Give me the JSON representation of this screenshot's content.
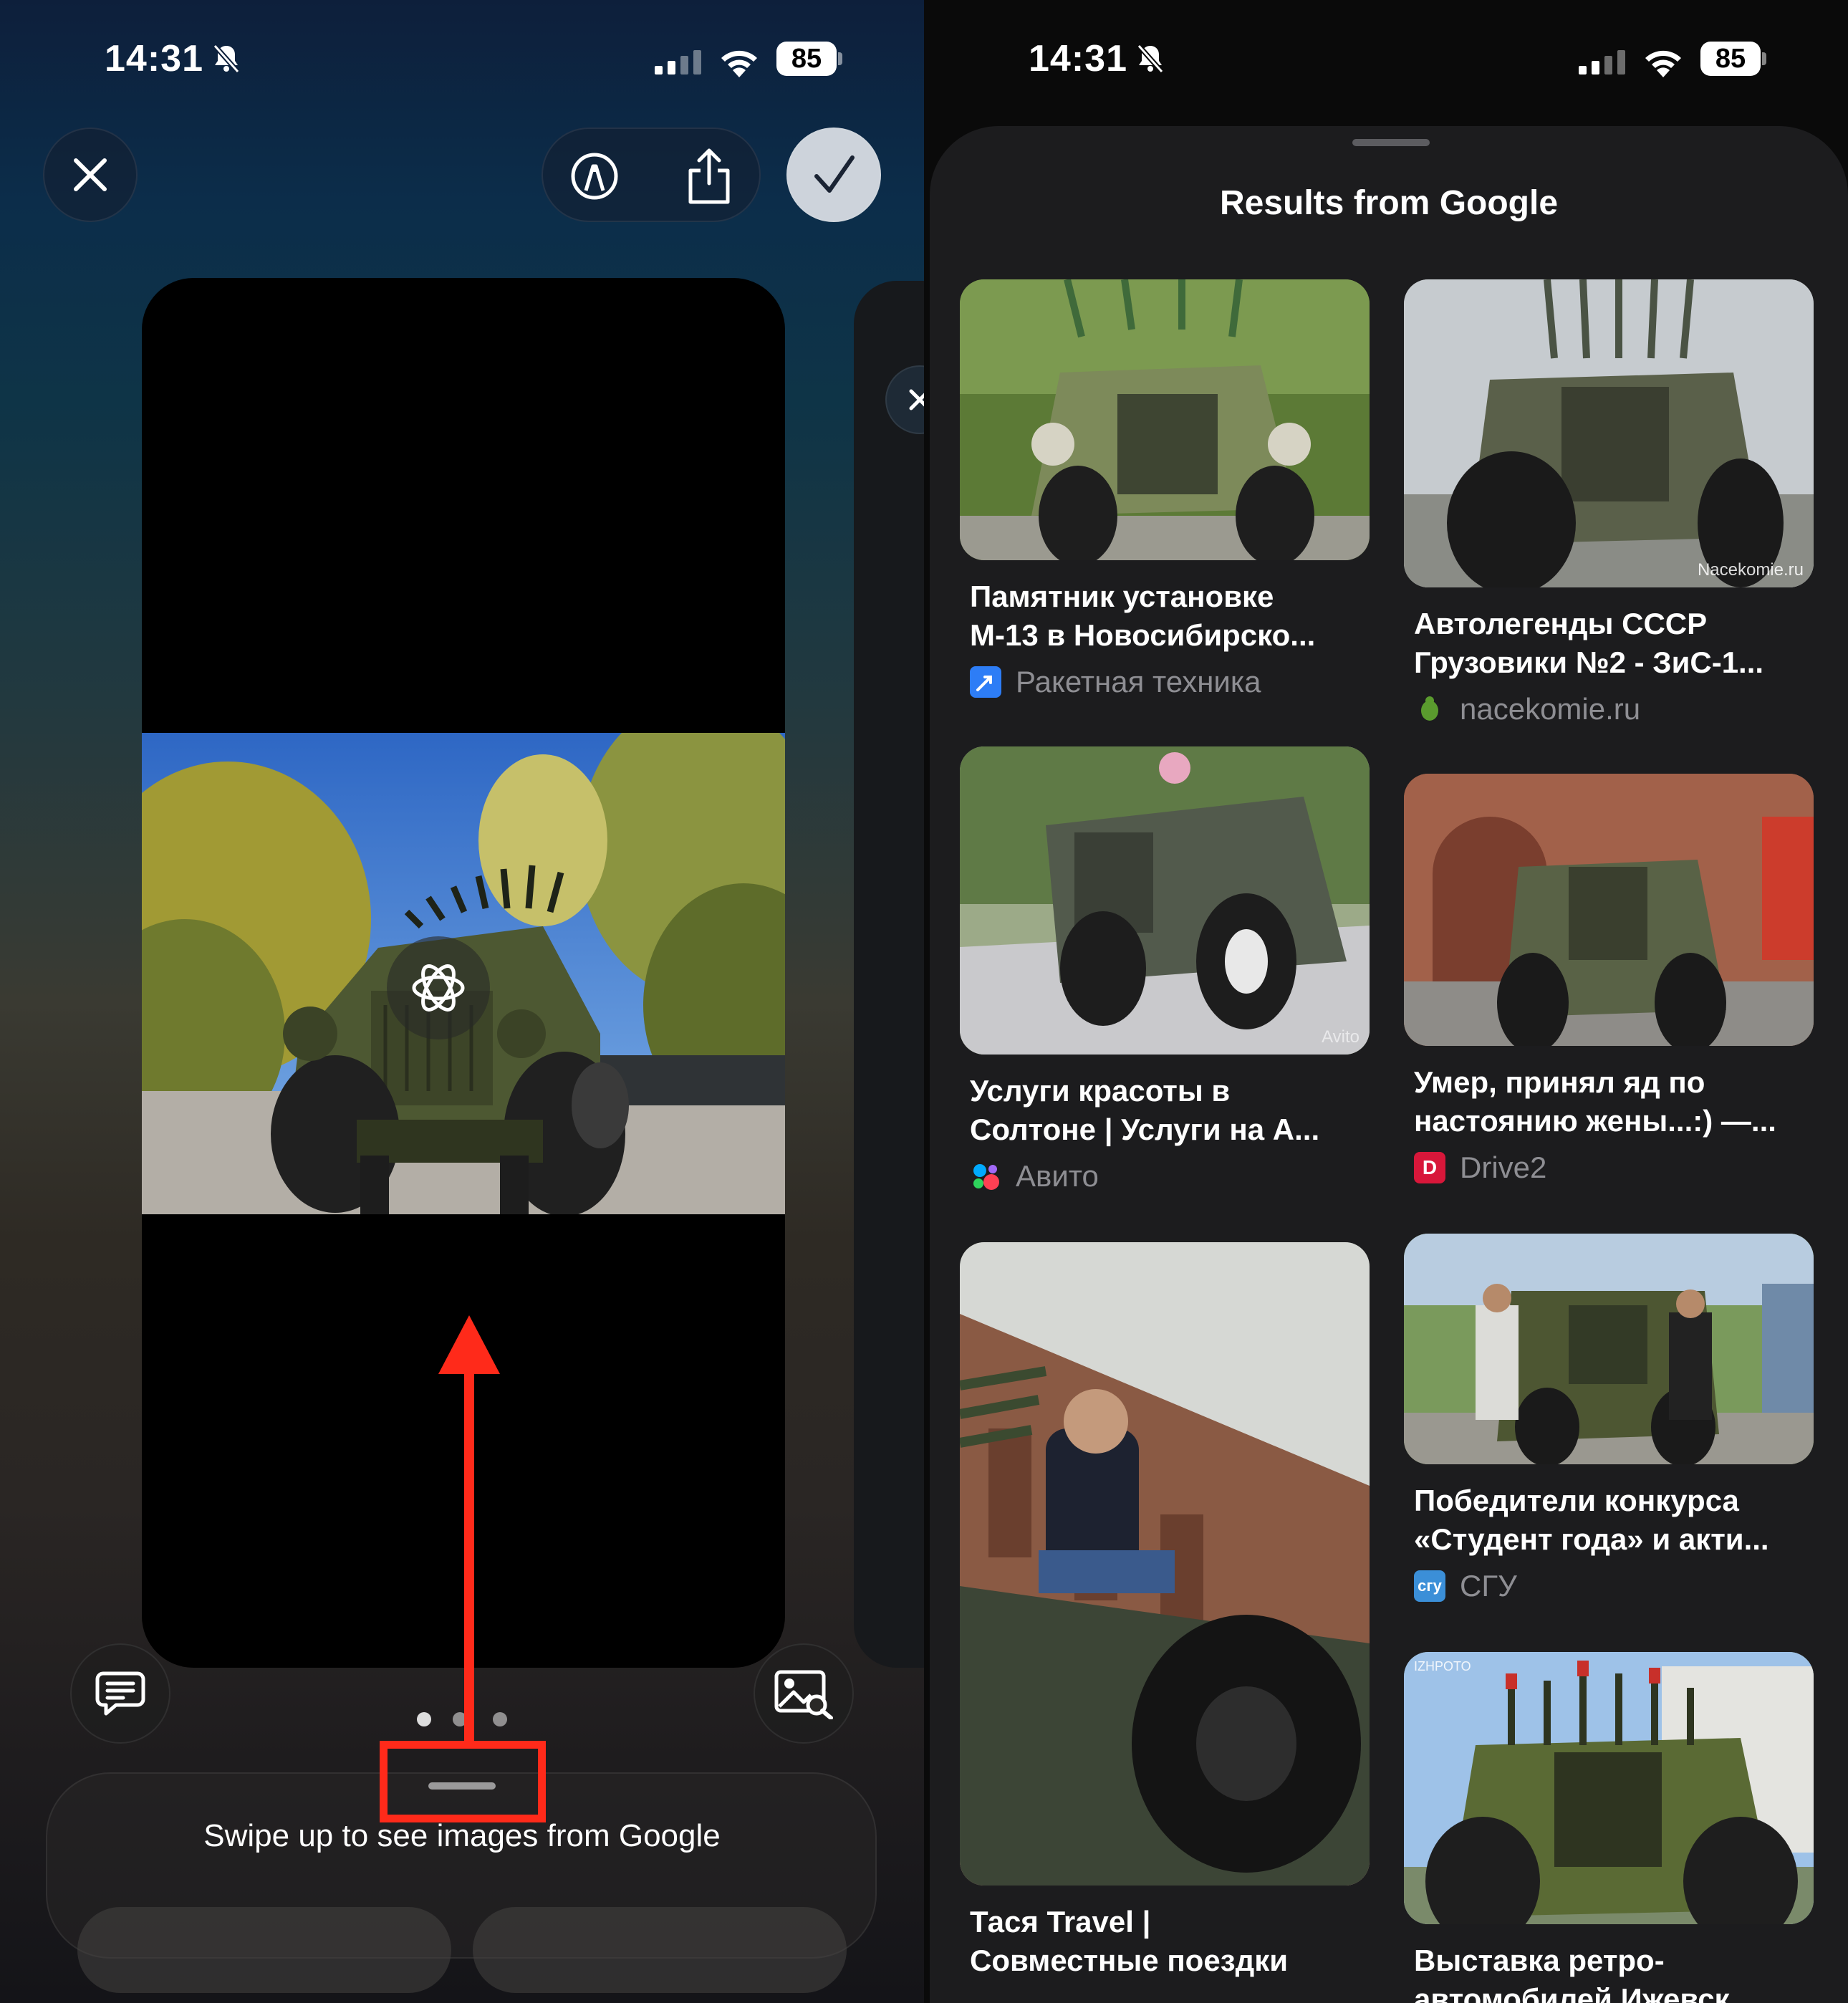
{
  "left_screen": {
    "status": {
      "time": "14:31",
      "battery": "85"
    },
    "page_dots": 3,
    "swipe_hint": "Swipe up to see images from Google"
  },
  "right_screen": {
    "status": {
      "time": "14:31",
      "battery": "85"
    },
    "title": "Results from Google",
    "results": [
      {
        "title": "Памятник установке\nМ-13 в Новосибирско...",
        "source": "Ракетная техника",
        "icon_color": "#2d7df6"
      },
      {
        "title": "Автолегенды СССР\nГрузовики №2 - ЗиС-1...",
        "source": "nacekomie.ru",
        "icon_color": "#5a9b2e",
        "watermark": "Nacekomie.ru"
      },
      {
        "title": "Услуги красоты в\nСолтоне | Услуги на А...",
        "source": "Авито",
        "icon_color": "#00aaff"
      },
      {
        "title": "Умер, принял яд по\nнастоянию жены...:) —...",
        "source": "Drive2",
        "icon_color": "#d8173a",
        "icon_letter": "D"
      },
      {
        "title": "Тася Travel |\nСовместные поездки",
        "source": "",
        "icon_color": "#777777"
      },
      {
        "title": "Победители конкурса\n«Студент года» и акти...",
        "source": "СГУ",
        "icon_color": "#3b8fd8",
        "icon_letter": "сгу"
      },
      {
        "title": "Выставка ретро-\nавтомобилей Ижевск",
        "source": "",
        "icon_color": "#777777",
        "watermark": "IZHPOTO"
      }
    ]
  },
  "colors": {
    "annotation": "#ff2a1a",
    "sheet": "#1c1c1e",
    "check_button": "#cdd3db"
  }
}
